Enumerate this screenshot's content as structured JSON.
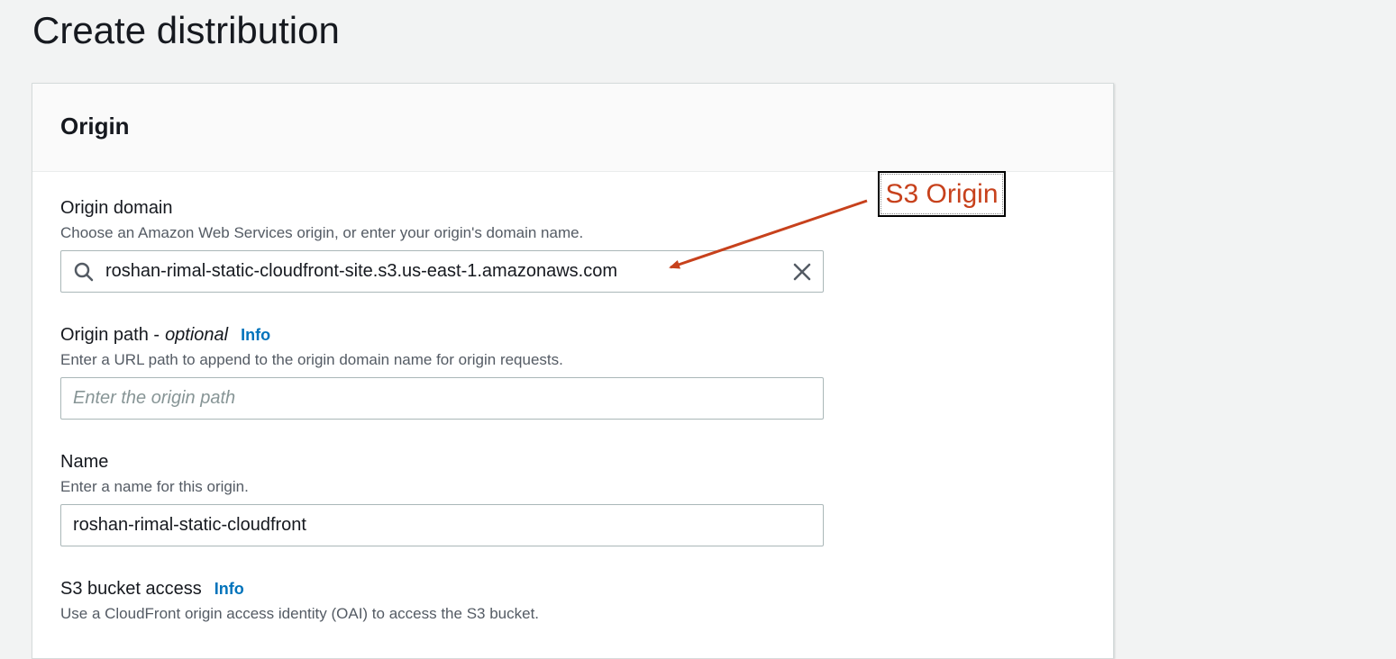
{
  "page": {
    "title": "Create distribution"
  },
  "panel": {
    "title": "Origin"
  },
  "origin_domain": {
    "label": "Origin domain",
    "description": "Choose an Amazon Web Services origin, or enter your origin's domain name.",
    "value": "roshan-rimal-static-cloudfront-site.s3.us-east-1.amazonaws.com",
    "search_icon": "search-icon",
    "clear_icon": "close-icon"
  },
  "origin_path": {
    "label": "Origin path -",
    "optional": "optional",
    "info": "Info",
    "description": "Enter a URL path to append to the origin domain name for origin requests.",
    "placeholder": "Enter the origin path"
  },
  "name": {
    "label": "Name",
    "description": "Enter a name for this origin.",
    "value": "roshan-rimal-static-cloudfront"
  },
  "s3_bucket_access": {
    "label": "S3 bucket access",
    "info": "Info",
    "description": "Use a CloudFront origin access identity (OAI) to access the S3 bucket."
  },
  "annotation": {
    "text": "S3 Origin",
    "color": "#c7411c"
  },
  "colors": {
    "link": "#0073bb",
    "background": "#f2f3f3",
    "text": "#16191f",
    "secondary_text": "#545b64"
  }
}
